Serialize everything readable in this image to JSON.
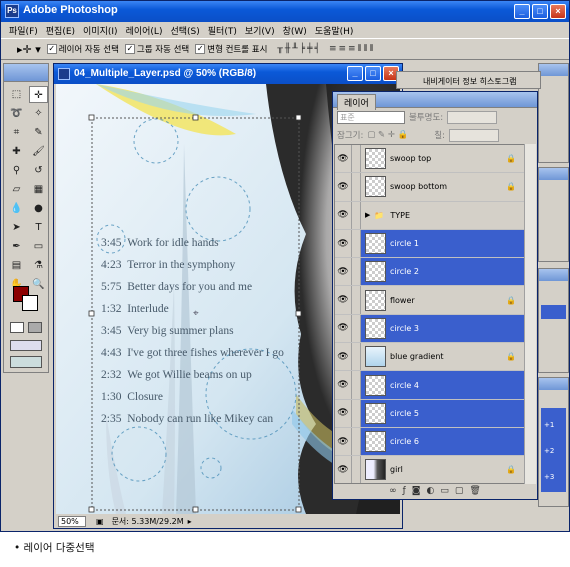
{
  "app": {
    "title": "Adobe Photoshop"
  },
  "menu": [
    "파일(F)",
    "편집(E)",
    "이미지(I)",
    "레이어(L)",
    "선택(S)",
    "필터(T)",
    "보기(V)",
    "창(W)",
    "도움말(H)"
  ],
  "options": {
    "auto_select_layer": "레이어 자동 선택",
    "auto_select_group": "그룹 자동 선택",
    "show_transform_controls": "변형 컨트롤 표시"
  },
  "document": {
    "title": "04_Multiple_Layer.psd @ 50% (RGB/8)",
    "zoom": "50%",
    "doc_size": "문서: 5.33M/29.2M",
    "tracks": [
      {
        "time": "3:45",
        "title": "Work for idle hands"
      },
      {
        "time": "4:23",
        "title": "Terror in the symphony"
      },
      {
        "time": "5:75",
        "title": "Better days for you and me"
      },
      {
        "time": "1:32",
        "title": "Interlude"
      },
      {
        "time": "3:45",
        "title": "Very big summer plans"
      },
      {
        "time": "4:43",
        "title": "I've got three fishes wherever I go"
      },
      {
        "time": "2:32",
        "title": "We got Willie beams on up"
      },
      {
        "time": "1:30",
        "title": "Closure"
      },
      {
        "time": "2:35",
        "title": "Nobody can run like Mikey can"
      }
    ]
  },
  "layers_panel": {
    "tab": "레이어",
    "blend_mode": "표준",
    "opacity_label": "불투명도:",
    "lock_label": "잠그기:",
    "fill_label": "칠:",
    "layers": [
      {
        "name": "swoop top",
        "selected": false,
        "locked": true,
        "thumb": "checker"
      },
      {
        "name": "swoop bottom",
        "selected": false,
        "locked": true,
        "thumb": "checker"
      },
      {
        "name": "TYPE",
        "selected": false,
        "locked": false,
        "thumb": "folder"
      },
      {
        "name": "circle 1",
        "selected": true,
        "locked": false,
        "thumb": "checker"
      },
      {
        "name": "circle 2",
        "selected": true,
        "locked": false,
        "thumb": "checker"
      },
      {
        "name": "flower",
        "selected": false,
        "locked": true,
        "thumb": "checker"
      },
      {
        "name": "circle 3",
        "selected": true,
        "locked": false,
        "thumb": "checker"
      },
      {
        "name": "blue gradient",
        "selected": false,
        "locked": true,
        "thumb": "grad"
      },
      {
        "name": "circle 4",
        "selected": true,
        "locked": false,
        "thumb": "checker"
      },
      {
        "name": "circle 5",
        "selected": true,
        "locked": false,
        "thumb": "checker"
      },
      {
        "name": "circle 6",
        "selected": true,
        "locked": false,
        "thumb": "checker"
      },
      {
        "name": "girl",
        "selected": false,
        "locked": true,
        "thumb": "girl"
      }
    ]
  },
  "side_panels": {
    "navigator_tab": "내비게이터",
    "info_tab": "정보",
    "histogram_tab": "히스토그램"
  },
  "caption": "• 레이어 다중선택"
}
